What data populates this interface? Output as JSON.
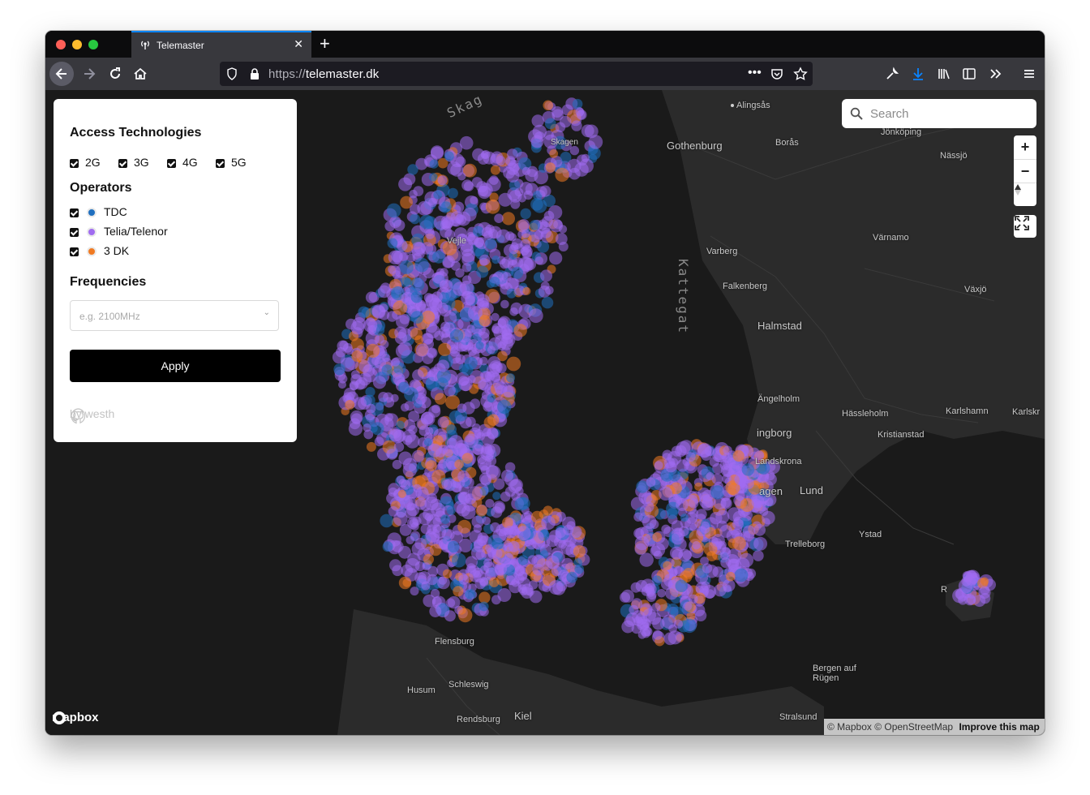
{
  "browser": {
    "tab_title": "Telemaster",
    "url_scheme": "https://",
    "url_host": "telemaster.dk"
  },
  "panel": {
    "access_title": "Access Technologies",
    "technologies": [
      {
        "label": "2G",
        "checked": true
      },
      {
        "label": "3G",
        "checked": true
      },
      {
        "label": "4G",
        "checked": true
      },
      {
        "label": "5G",
        "checked": true
      }
    ],
    "operators_title": "Operators",
    "operators": [
      {
        "label": "TDC",
        "color": "#1f6fbf",
        "checked": true
      },
      {
        "label": "Telia/Telenor",
        "color": "#a06cf0",
        "checked": true
      },
      {
        "label": "3 DK",
        "color": "#f07a22",
        "checked": true
      }
    ],
    "frequencies_title": "Frequencies",
    "frequencies_placeholder": "e.g. 2100MHz",
    "apply_label": "Apply",
    "credit": "by westh"
  },
  "map": {
    "search_placeholder": "Search",
    "attribution": "© Mapbox © OpenStreetMap",
    "improve_label": "Improve this map",
    "logo_text": "mapbox",
    "colors": {
      "tdc": "#1f6fbf",
      "telia": "#a06cf0",
      "three": "#f07a22"
    },
    "sea_labels": [
      "Skag",
      "Kattegat"
    ],
    "places": [
      "Alingsås",
      "Gothenburg",
      "Borås",
      "Jönköping",
      "Nässjö",
      "Skagen",
      "Varberg",
      "Värnamo",
      "Falkenberg",
      "Växjö",
      "Halmstad",
      "Ängelholm",
      "Hässleholm",
      "Karlshamn",
      "Karlskr",
      "Kristianstad",
      "ingborg",
      "Landskrona",
      "agen",
      "Lund",
      "Ystad",
      "Trelleborg",
      "Husum",
      "Schleswig",
      "Rendsburg",
      "Kiel",
      "Bergen auf Rügen",
      "Stralsund",
      "Flensburg",
      "Vejle",
      "R"
    ]
  }
}
